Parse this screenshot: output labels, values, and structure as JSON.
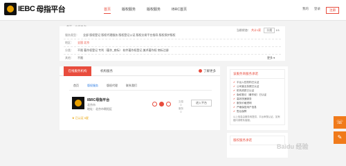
{
  "header": {
    "logo_text": "IEBC",
    "logo_suffix": "母指平台",
    "nav": [
      "首页",
      "版权服务",
      "版权服务",
      "IBRC首页"
    ],
    "right_links": [
      "我的",
      "登录",
      "注册"
    ]
  },
  "breadcrumb": "首页 > 在线查询",
  "filter": {
    "status_label": "当前状态：",
    "status_value": "共计1家",
    "sort_label": "分类",
    "sort_value": "1/1",
    "rows": [
      {
        "key": "服务类型：",
        "value": "全部   版权登记   版权代理服务   版权登记公证   版权交易平台指导   版权保护版权"
      },
      {
        "key": "地区：",
        "value": "全国   北京",
        "highlight": "全国"
      },
      {
        "key": "分类：",
        "value": "不限   著作权登记   专利（著作_商标）   软件著作权登记   美术著作权   商标注册"
      },
      {
        "key": "其他：",
        "value": "不限"
      }
    ],
    "more": "更多 ▾"
  },
  "tabs": {
    "active": "在线服务机构",
    "second": "机构服务",
    "right": "了解更多"
  },
  "subtabs": [
    "首页",
    "版权服务",
    "版权代理",
    "联系我们"
  ],
  "card": {
    "name": "IBRC母指平台",
    "meta": [
      "北京市",
      "地址：北京市朝阳区"
    ],
    "stars": "♛ 已认证 5星",
    "counts": [
      "交易",
      "0",
      "服务",
      "0"
    ],
    "detail_button": "进入平台"
  },
  "side": {
    "title": "该服务商服务承诺",
    "items": [
      "平台入驻机构已认证",
      "公司营业执照已认证",
      "机构资质已认证",
      "版权登记（著作权）已认证",
      "高效快速服务",
      "服务价格透明",
      "严格保密用户信息",
      "售后保障"
    ],
    "note": "以上信息由服务商提供，平台审核认证，如有疑问请联系客服。",
    "second_title": "版权服务承诺"
  },
  "floats": [
    "☏",
    "✎"
  ],
  "watermark": "Baidu 经验"
}
